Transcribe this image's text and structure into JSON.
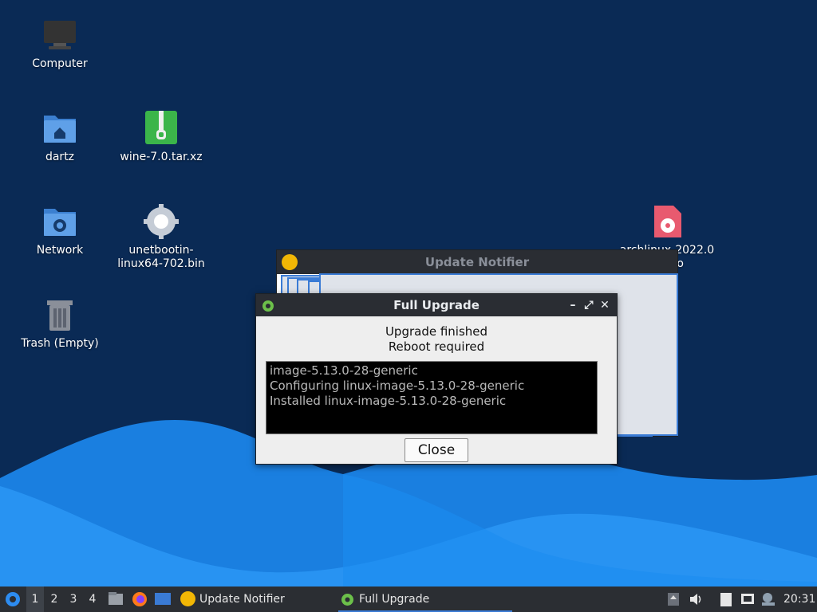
{
  "desktop": {
    "icons": [
      {
        "label": "Computer",
        "icon": "computer-icon"
      },
      {
        "label": "dartz",
        "icon": "home-folder-icon"
      },
      {
        "label": "wine-7.0.tar.xz",
        "icon": "archive-icon"
      },
      {
        "label": "Network",
        "icon": "network-folder-icon"
      },
      {
        "label_line1": "unetbootin-",
        "label_line2": "linux64-702.bin",
        "icon": "gear-file-icon"
      },
      {
        "label_line1": "archlinux-2022.0",
        "label_line2": "64.iso",
        "icon": "disc-image-icon"
      },
      {
        "label": "Trash (Empty)",
        "icon": "trash-icon"
      }
    ]
  },
  "windows": {
    "notifier": {
      "title": "Update Notifier"
    },
    "full_upgrade": {
      "title": "Full Upgrade",
      "message_line1": "Upgrade finished",
      "message_line2": "Reboot required",
      "log_lines": [
        "image-5.13.0-28-generic",
        "Configuring linux-image-5.13.0-28-generic",
        "Installed linux-image-5.13.0-28-generic"
      ],
      "close_label": "Close",
      "minimize_glyph": "–",
      "maximize_glyph": "⤢",
      "close_glyph": "✕"
    }
  },
  "taskbar": {
    "workspaces": [
      "1",
      "2",
      "3",
      "4"
    ],
    "tasks": [
      {
        "label": "Update Notifier",
        "icon": "update-notifier-icon"
      },
      {
        "label": "Full Upgrade",
        "icon": "gear-icon"
      }
    ],
    "clock": "20:31"
  },
  "colors": {
    "accent": "#3a7bd5",
    "background": "#0a2a55",
    "taskbar": "#2b2e33"
  }
}
